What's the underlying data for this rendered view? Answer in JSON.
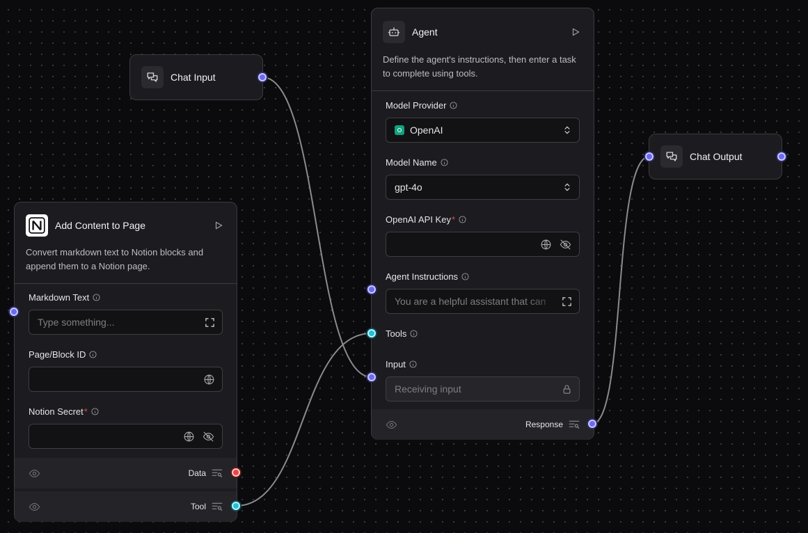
{
  "chat_input": {
    "title": "Chat Input"
  },
  "chat_output": {
    "title": "Chat Output"
  },
  "agent": {
    "title": "Agent",
    "description": "Define the agent's instructions, then enter a task to complete using tools.",
    "model_provider": {
      "label": "Model Provider",
      "value": "OpenAI"
    },
    "model_name": {
      "label": "Model Name",
      "value": "gpt-4o"
    },
    "api_key": {
      "label": "OpenAI API Key",
      "required_mark": "*"
    },
    "instructions": {
      "label": "Agent Instructions",
      "placeholder": "You are a helpful assistant that can"
    },
    "tools": {
      "label": "Tools"
    },
    "input": {
      "label": "Input",
      "placeholder": "Receiving input"
    },
    "footer": {
      "output_label": "Response"
    }
  },
  "notion": {
    "title": "Add Content to Page",
    "description": "Convert markdown text to Notion blocks and append them to a Notion page.",
    "markdown": {
      "label": "Markdown Text",
      "placeholder": "Type something..."
    },
    "page_id": {
      "label": "Page/Block ID"
    },
    "secret": {
      "label": "Notion Secret",
      "required_mark": "*"
    },
    "outputs": {
      "data_label": "Data",
      "tool_label": "Tool"
    }
  },
  "colors": {
    "handle_blue": "#6b6bf0",
    "handle_cyan": "#22c0d8",
    "handle_red": "#ef4444",
    "required": "#ef4444"
  }
}
